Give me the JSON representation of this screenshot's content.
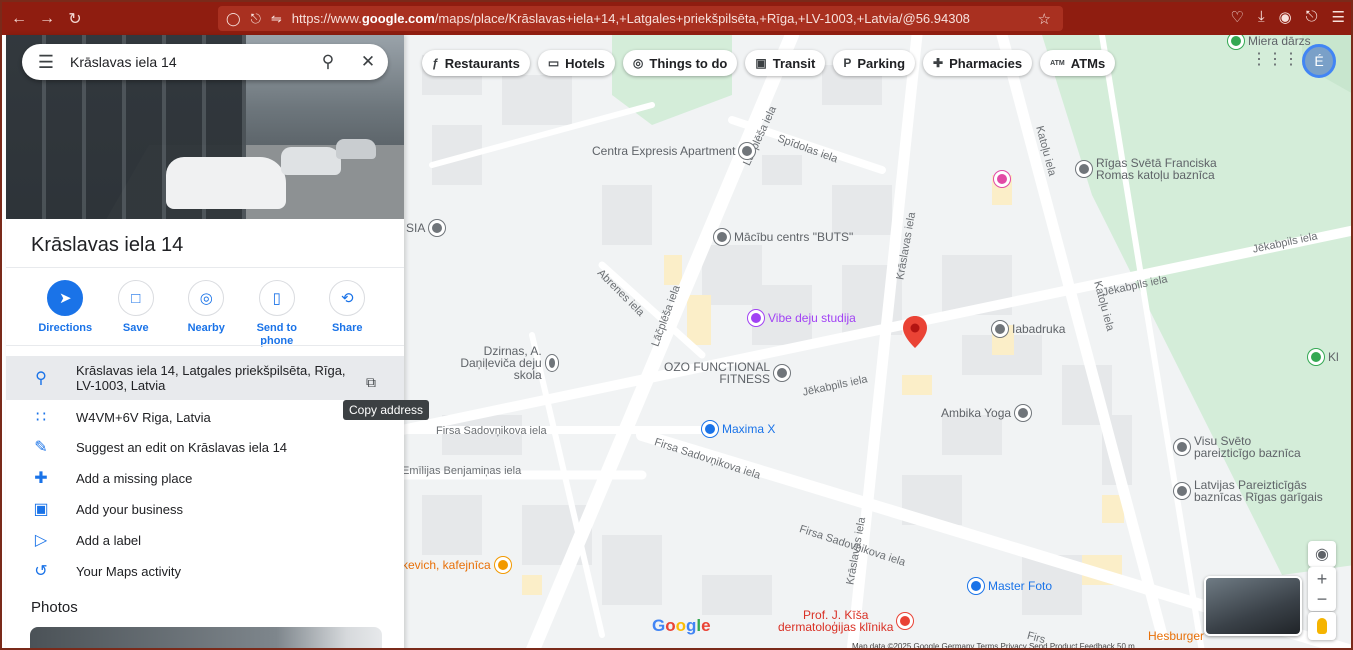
{
  "browser": {
    "url_prefix": "https://www.",
    "url_domain": "google.com",
    "url_rest": "/maps/place/Krāslavas+iela+14,+Latgales+priekšpilsēta,+Rīga,+LV-1003,+Latvia/@56.94308",
    "icons": [
      "back-icon",
      "forward-icon",
      "reload-icon",
      "shield-icon",
      "lock-icon",
      "permissions-icon",
      "star-icon",
      "pocket-icon",
      "download-icon",
      "account-icon",
      "extensions-icon",
      "menu-icon"
    ]
  },
  "search": {
    "query": "Krāslavas iela 14"
  },
  "place": {
    "title": "Krāslavas iela 14"
  },
  "actions": [
    {
      "label": "Directions",
      "icon": "directions-icon"
    },
    {
      "label": "Save",
      "icon": "bookmark-icon"
    },
    {
      "label": "Nearby",
      "icon": "nearby-icon"
    },
    {
      "label": "Send to phone",
      "label1": "Send to",
      "label2": "phone",
      "icon": "send-to-phone-icon"
    },
    {
      "label": "Share",
      "icon": "share-icon"
    }
  ],
  "info": {
    "address_line1": "Krāslavas iela 14, Latgales priekšpilsēta, Rīga,",
    "address_line2": "LV-1003, Latvia",
    "plus_code": "W4VM+6V Riga, Latvia",
    "suggest_edit": "Suggest an edit on Krāslavas iela 14",
    "add_missing": "Add a missing place",
    "add_business": "Add your business",
    "add_label": "Add a label",
    "maps_activity": "Your Maps activity"
  },
  "tooltip": "Copy address",
  "photos_title": "Photos",
  "chips": [
    {
      "label": "Restaurants",
      "icon": "ƒ"
    },
    {
      "label": "Hotels",
      "icon": "▭"
    },
    {
      "label": "Things to do",
      "icon": "◎"
    },
    {
      "label": "Transit",
      "icon": "▣"
    },
    {
      "label": "Parking",
      "icon": "P"
    },
    {
      "label": "Pharmacies",
      "icon": "✚"
    },
    {
      "label": "ATMs",
      "icon": "ATM"
    }
  ],
  "avatar_letter": "É",
  "map": {
    "streets": {
      "lacplesa1": "Lāčplēša iela",
      "lacplesa2": "Lāčplēša iela",
      "spidolas": "Spīdolas iela",
      "kraslavas1": "Krāslavas iela",
      "kraslavas2": "Krāslavas iela",
      "katolu1": "Katoļu iela",
      "katolu2": "Katoļu iela",
      "jekabpils1": "Jēkabpils iela",
      "jekabpils2": "Jēkabpils iela",
      "jekabpils3": "Jēkabpils iela",
      "abrenes": "Abrenes iela",
      "firsa1": "Firsa Sadovņikova iela",
      "firsa2": "Firsa Sadovņikova iela",
      "firsa3": "Firsa Sadovņikova iela",
      "emilijas": "Emīlijas Benjamiņas iela",
      "firsa_short": "Firsa Sadovņikova iela",
      "firsa_edge": "Firs"
    },
    "pois": {
      "centra": "Centra Expresis Apartment",
      "sia": "SIA",
      "macibu": "Mācību centrs \"BUTS\"",
      "vibe": "Vibe deju studija",
      "dzirnas": "Dzirnas, A. Daņiļeviča deju skola",
      "ozo1": "OZO FUNCTIONAL",
      "ozo2": "FITNESS",
      "iabadruka": "Iabadruka",
      "ambika": "Ambika Yoga",
      "maxima": "Maxima X",
      "visu1": "Visu Svēto",
      "visu2": "pareizticīgo baznīca",
      "latvijas1": "Latvijas Pareizticīgās",
      "latvijas2": "baznīcas Rīgas garīgais",
      "rigas1": "Rīgas Svētā Franciska",
      "rigas2": "Romas katoļu baznīca",
      "miera": "Miera dārzs",
      "kafejnica": "kevich, kafejnīca",
      "master": "Master Foto",
      "kisa1": "Prof. J. Kīša",
      "kisa2": "dermatoloģijas klīnika",
      "hesburger": "Hesburger",
      "ki": "Kl"
    },
    "google_logo": "Google",
    "attribution": "Map data ©2025 Google   Germany   Terms   Privacy   Send Product Feedback   50 m"
  }
}
